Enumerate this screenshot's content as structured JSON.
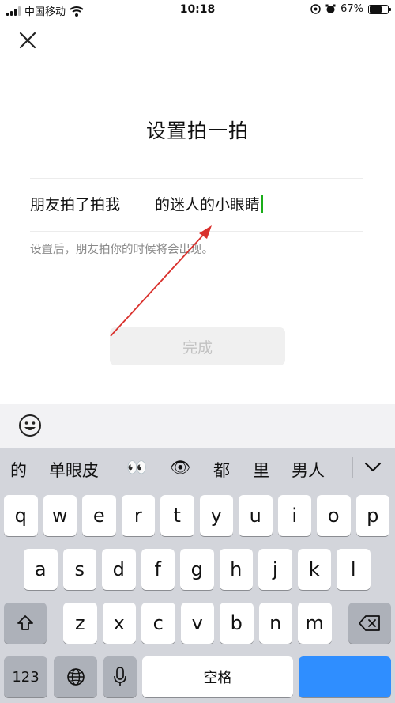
{
  "status_bar": {
    "carrier": "中国移动",
    "time": "10:18",
    "battery": "67%",
    "battery_level": 0.67,
    "icons": [
      "signal-icon",
      "wifi-icon",
      "location-lock-icon",
      "alarm-icon",
      "battery-icon"
    ]
  },
  "page": {
    "title": "设置拍一拍",
    "pat_prefix": "朋友拍了拍我",
    "pat_input_value": "的迷人的小眼睛",
    "hint": "设置后，朋友拍你的时候将会出现。",
    "done_label": "完成"
  },
  "keyboard": {
    "candidates": [
      "的",
      "单眼皮",
      "👀",
      "👁",
      "都",
      "里",
      "男人"
    ],
    "row1": [
      "q",
      "w",
      "e",
      "r",
      "t",
      "y",
      "u",
      "i",
      "o",
      "p"
    ],
    "row2": [
      "a",
      "s",
      "d",
      "f",
      "g",
      "h",
      "j",
      "k",
      "l"
    ],
    "row3": [
      "z",
      "x",
      "c",
      "v",
      "b",
      "n",
      "m"
    ],
    "numbers_label": "123",
    "space_label": "空格"
  },
  "colors": {
    "caret": "#1aad19",
    "arrow": "#d9302c",
    "return_key": "#2f8eff"
  }
}
